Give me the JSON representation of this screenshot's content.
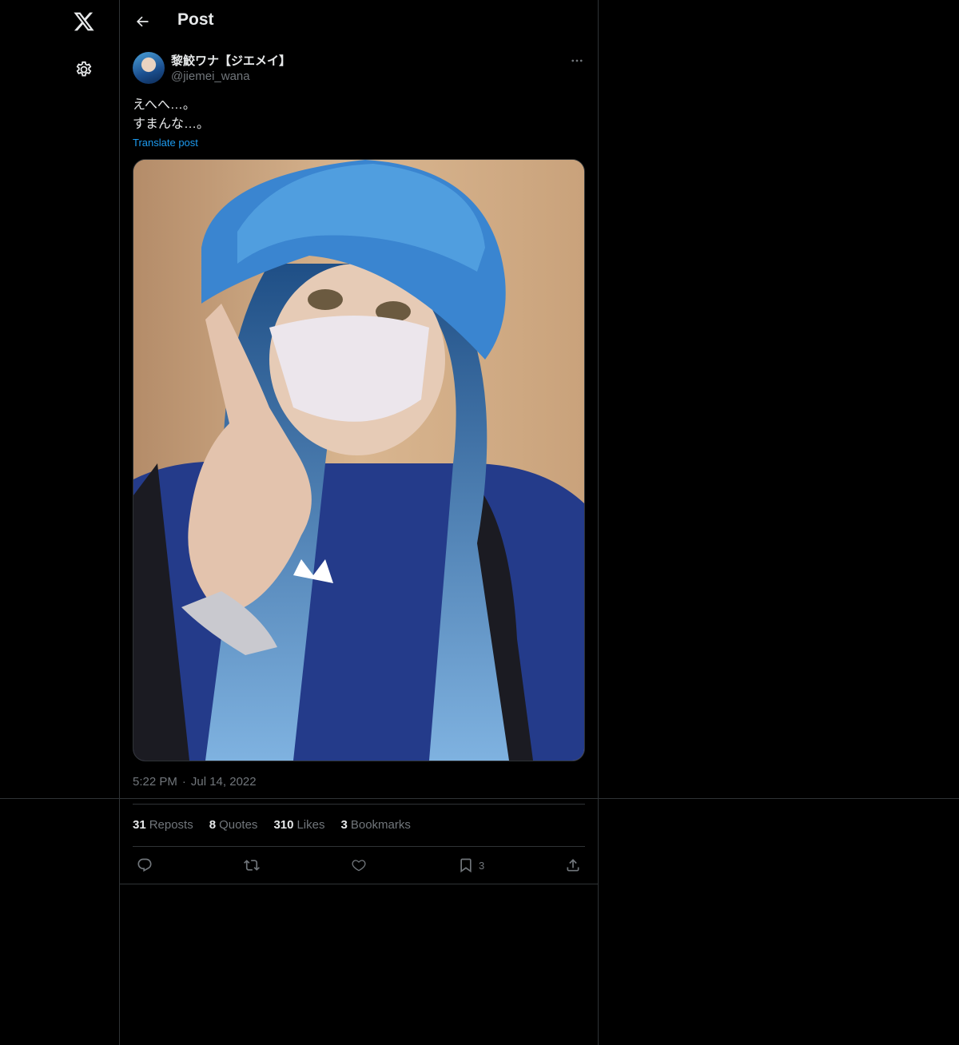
{
  "header": {
    "title": "Post"
  },
  "post": {
    "display_name": "黎鮫ワナ【ジエメイ】",
    "handle": "@jiemei_wana",
    "text_lines": [
      "えへへ…。",
      "すまんな…。"
    ],
    "translate_label": "Translate post",
    "time": "5:22 PM",
    "date": "Jul 14, 2022",
    "separator": "·"
  },
  "stats": {
    "reposts": {
      "count": "31",
      "label": "Reposts"
    },
    "quotes": {
      "count": "8",
      "label": "Quotes"
    },
    "likes": {
      "count": "310",
      "label": "Likes"
    },
    "bookmarks": {
      "count": "3",
      "label": "Bookmarks"
    }
  },
  "actions": {
    "bookmark_count": "3"
  },
  "icons": [
    "x-logo-icon",
    "gear-icon",
    "back-arrow-icon",
    "more-icon",
    "reply-icon",
    "repost-icon",
    "like-icon",
    "bookmark-icon",
    "share-icon"
  ],
  "colors": {
    "background": "#000000",
    "text": "#e7e9ea",
    "muted": "#71767b",
    "link": "#1d9bf0",
    "border": "#2f3336"
  }
}
